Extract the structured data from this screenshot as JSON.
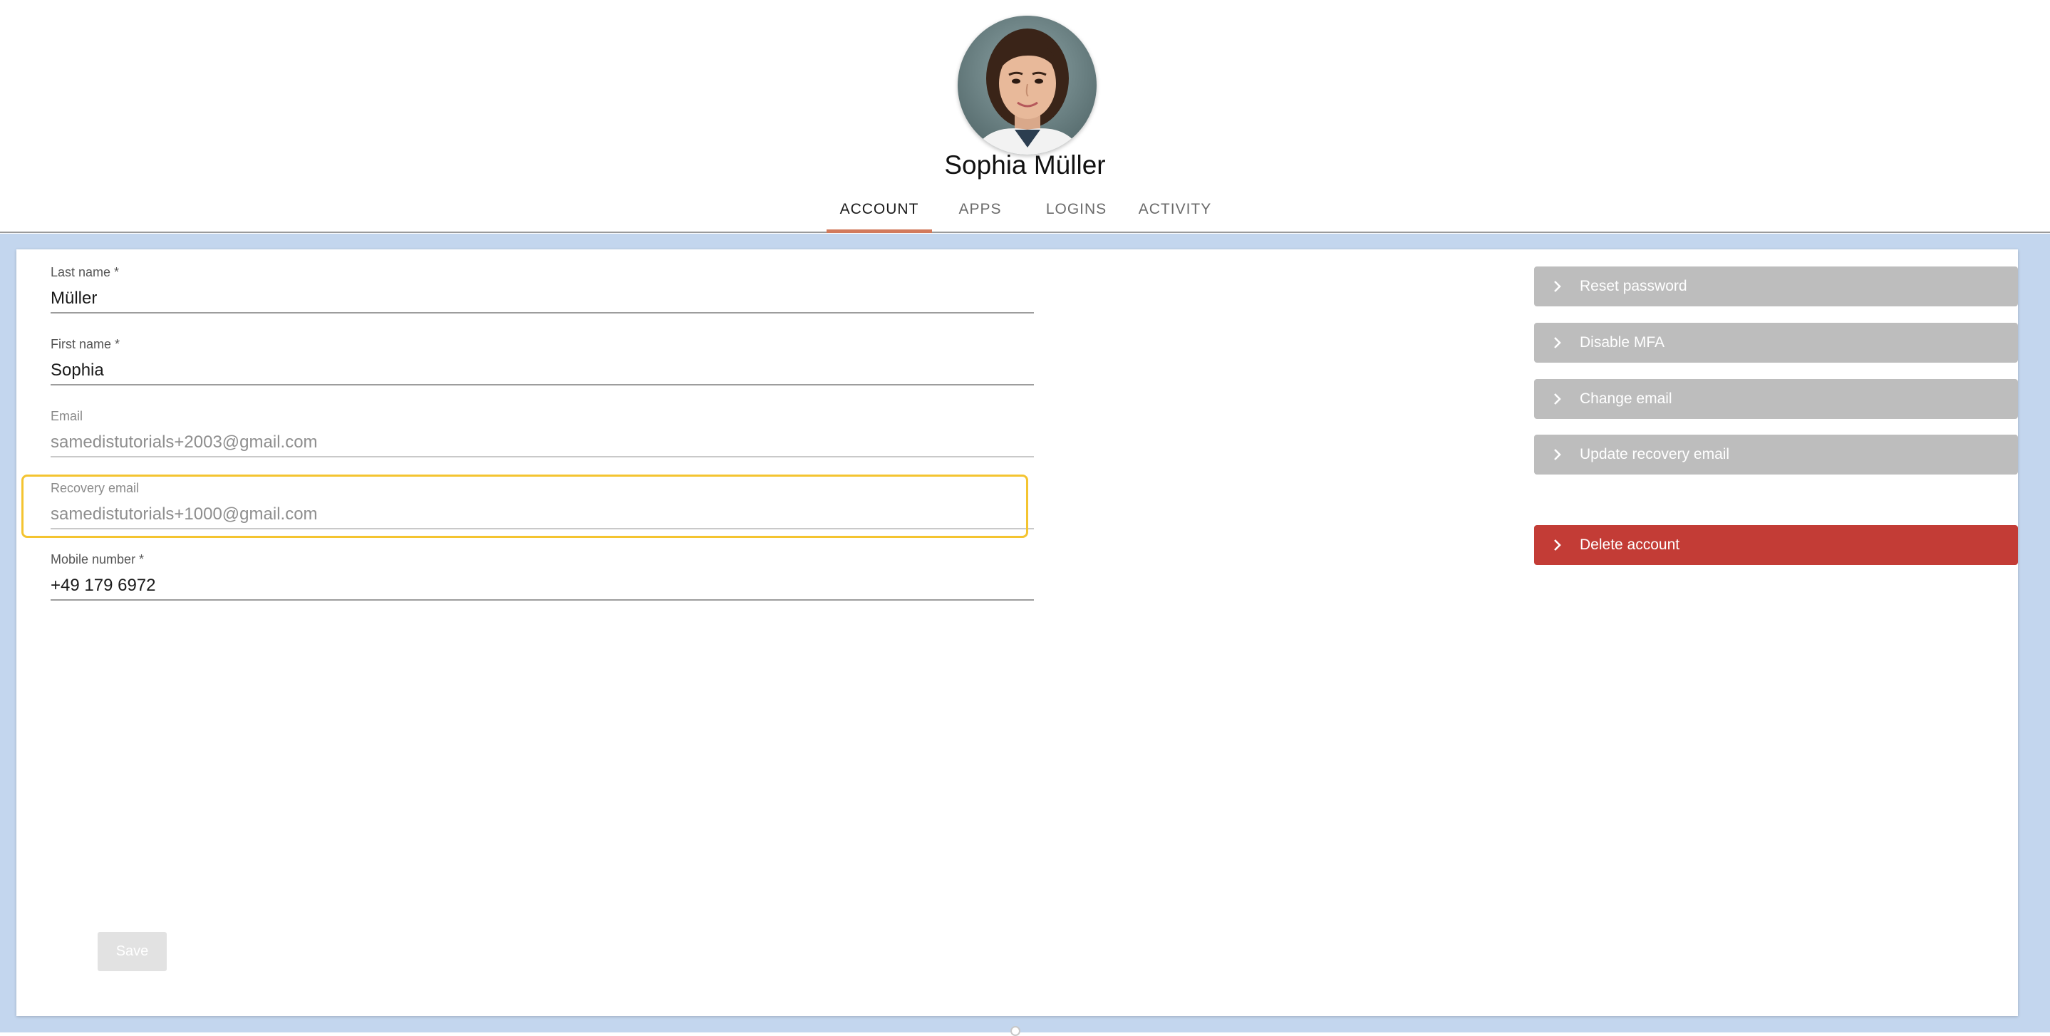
{
  "profile": {
    "name": "Sophia Müller"
  },
  "tabs": [
    {
      "label": "ACCOUNT",
      "active": true
    },
    {
      "label": "APPS",
      "active": false
    },
    {
      "label": "LOGINS",
      "active": false
    },
    {
      "label": "ACTIVITY",
      "active": false
    }
  ],
  "form": {
    "last_name": {
      "label": "Last name *",
      "value": "Müller"
    },
    "first_name": {
      "label": "First name *",
      "value": "Sophia"
    },
    "email": {
      "label": "Email",
      "value": "samedistutorials+2003@gmail.com"
    },
    "recovery_email": {
      "label": "Recovery email",
      "value": "samedistutorials+1000@gmail.com"
    },
    "mobile": {
      "label": "Mobile number *",
      "value": "+49 179 6972"
    },
    "save_label": "Save"
  },
  "actions": {
    "reset_password": "Reset password",
    "disable_mfa": "Disable MFA",
    "change_email": "Change email",
    "update_recovery_email": "Update recovery email",
    "delete_account": "Delete account"
  },
  "colors": {
    "page_background": "#c3d6ee",
    "tab_indicator": "#d27a5c",
    "focus_ring": "#f4c430",
    "action_disabled": "#bdbdbd",
    "danger": "#c33c36"
  },
  "icons": {
    "action_chevron": "chevron-right-icon"
  }
}
